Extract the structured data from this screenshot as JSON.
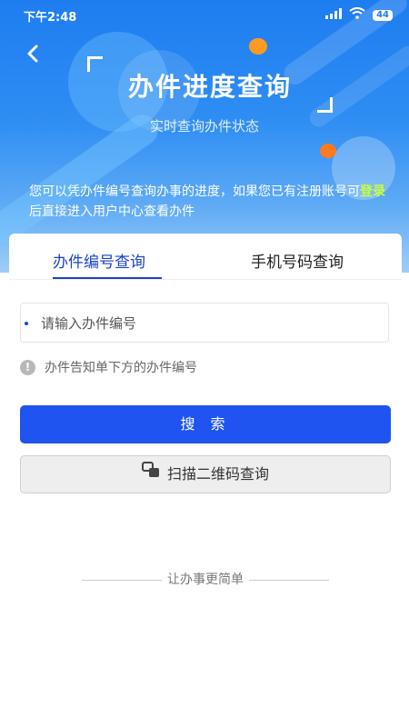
{
  "status_bar": {
    "time": "下午2:48",
    "battery": "44",
    "icons": [
      "signal-icon",
      "wifi-icon",
      "battery-icon"
    ]
  },
  "header": {
    "back_icon": "back-arrow-icon",
    "title": "办件进度查询",
    "subtitle": "实时查询办件状态"
  },
  "intro": {
    "text_before": "您可以凭办件编号查询办事的进度，如果您已有注册账号可",
    "login_link": "登录",
    "text_after": "后直接进入用户中心查看办件"
  },
  "tabs": [
    {
      "label": "办件编号查询",
      "active": true
    },
    {
      "label": "手机号码查询",
      "active": false
    }
  ],
  "search": {
    "placeholder": "请输入办件编号",
    "value": "",
    "hint": "办件告知单下方的办件编号"
  },
  "buttons": {
    "search_label": "搜 索",
    "scan_label": "扫描二维码查询",
    "scan_icon": "scan-qr-icon"
  },
  "footer": {
    "slogan": "让办事更简单"
  },
  "colors": {
    "primary": "#1f54f0",
    "hero_top": "#1e7df0",
    "accent_orange": "#ff8a1f",
    "login_link": "#c8ff3c",
    "tab_active": "#1a44c8"
  }
}
